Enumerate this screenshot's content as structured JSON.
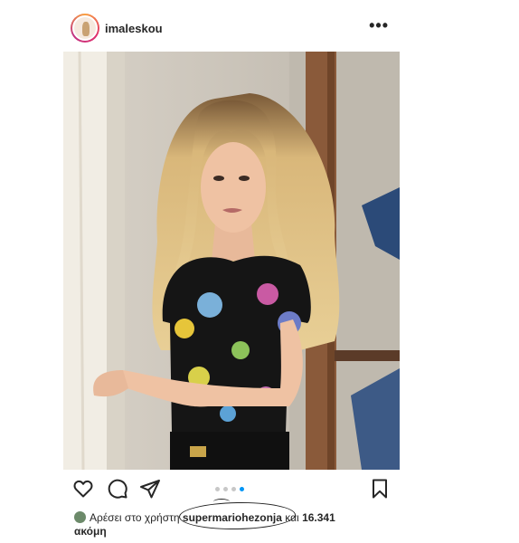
{
  "post": {
    "username": "imaleskou",
    "more_icon": "more-horizontal-icon",
    "likes": {
      "prefix": "Αρέσει στο χρήστη",
      "liker": "supermariohezonja",
      "middle": "και",
      "count": "16.341",
      "suffix": "ακόμη"
    },
    "carousel": {
      "total": 4,
      "active": 4
    },
    "icons": [
      "heart-icon",
      "comment-icon",
      "send-icon",
      "bookmark-icon"
    ],
    "colors": {
      "accent": "#0095f6",
      "text": "#262626"
    }
  }
}
